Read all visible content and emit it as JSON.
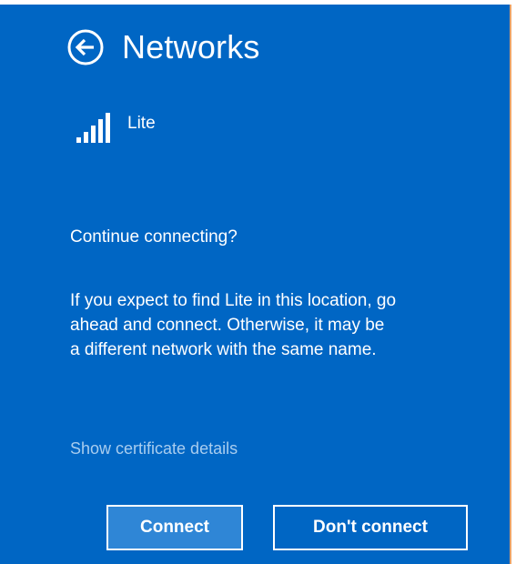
{
  "header": {
    "title": "Networks",
    "back_icon": "back-arrow-circle-icon"
  },
  "network": {
    "name": "Lite",
    "signal_icon": "wifi-signal-icon"
  },
  "prompt": {
    "question": "Continue connecting?",
    "message": "If you expect to find Lite in this location, go ahead and connect. Otherwise, it may be a different network with the same name."
  },
  "links": {
    "certificate": "Show certificate details"
  },
  "buttons": {
    "connect": "Connect",
    "dont_connect": "Don't connect"
  },
  "colors": {
    "panel_background": "#0066c4",
    "text": "#ffffff",
    "link": "#a8cdef",
    "primary_button": "#2f86d6",
    "border_accent": "#e8a36a"
  }
}
